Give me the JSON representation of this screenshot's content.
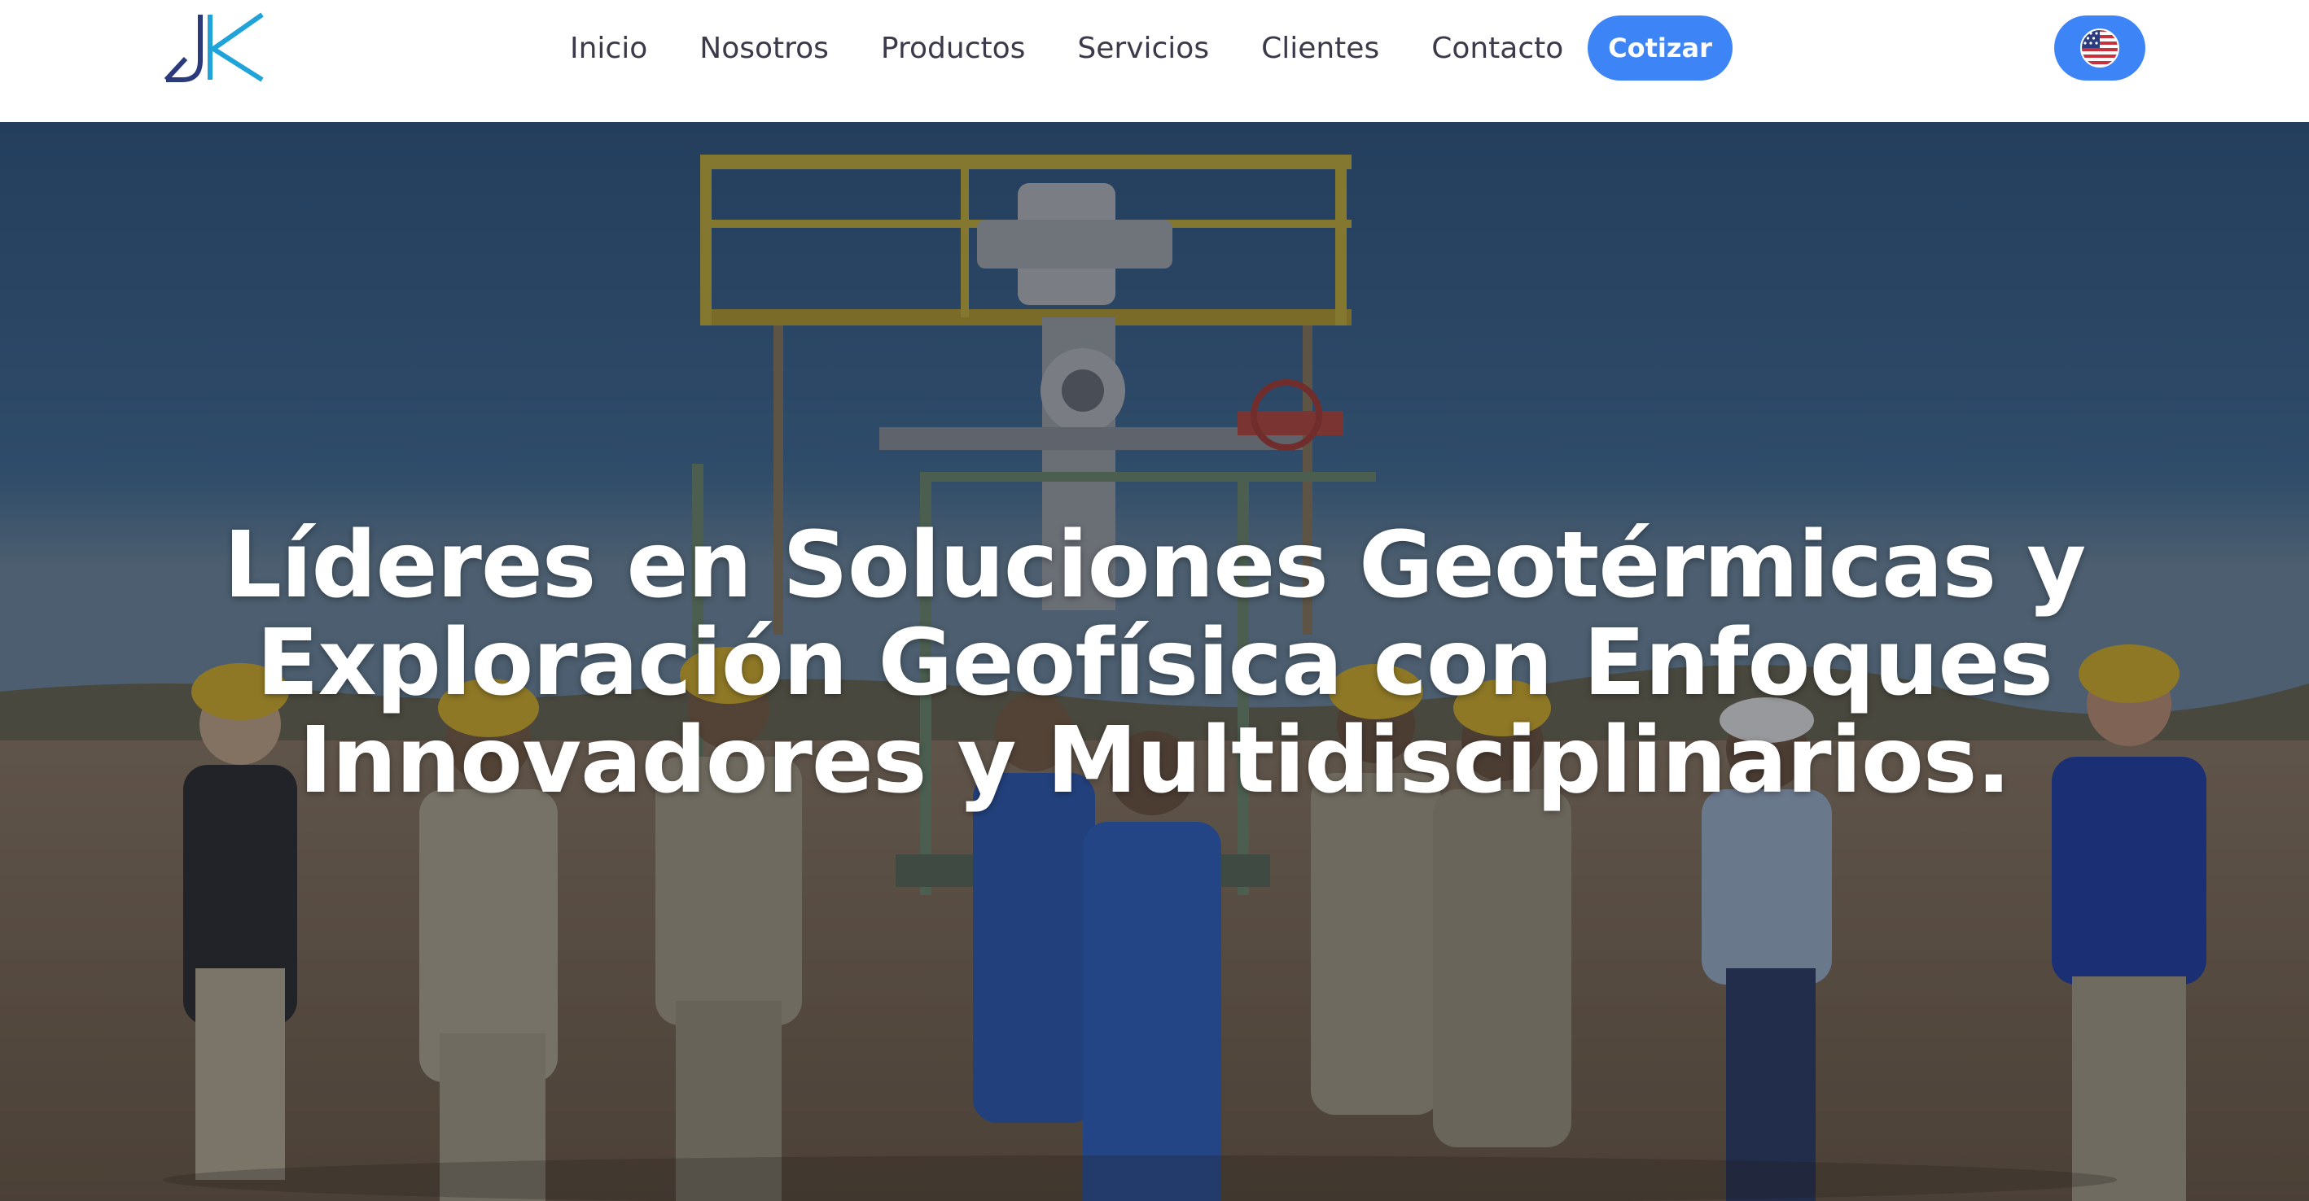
{
  "header": {
    "logo_text": "JK",
    "nav": [
      {
        "label": "Inicio"
      },
      {
        "label": "Nosotros"
      },
      {
        "label": "Productos"
      },
      {
        "label": "Servicios"
      },
      {
        "label": "Clientes"
      },
      {
        "label": "Contacto"
      }
    ],
    "cta_label": "Cotizar",
    "language_icon": "us-flag-icon"
  },
  "hero": {
    "title": "Líderes en Soluciones Geotérmicas y Exploración Geofísica con Enfoques Innovadores y Multidisciplinarios."
  },
  "colors": {
    "accent": "#3d84f7",
    "logo_dark": "#2b3a7a",
    "logo_light": "#1fa3d8",
    "nav_text": "#3a3a4a"
  }
}
